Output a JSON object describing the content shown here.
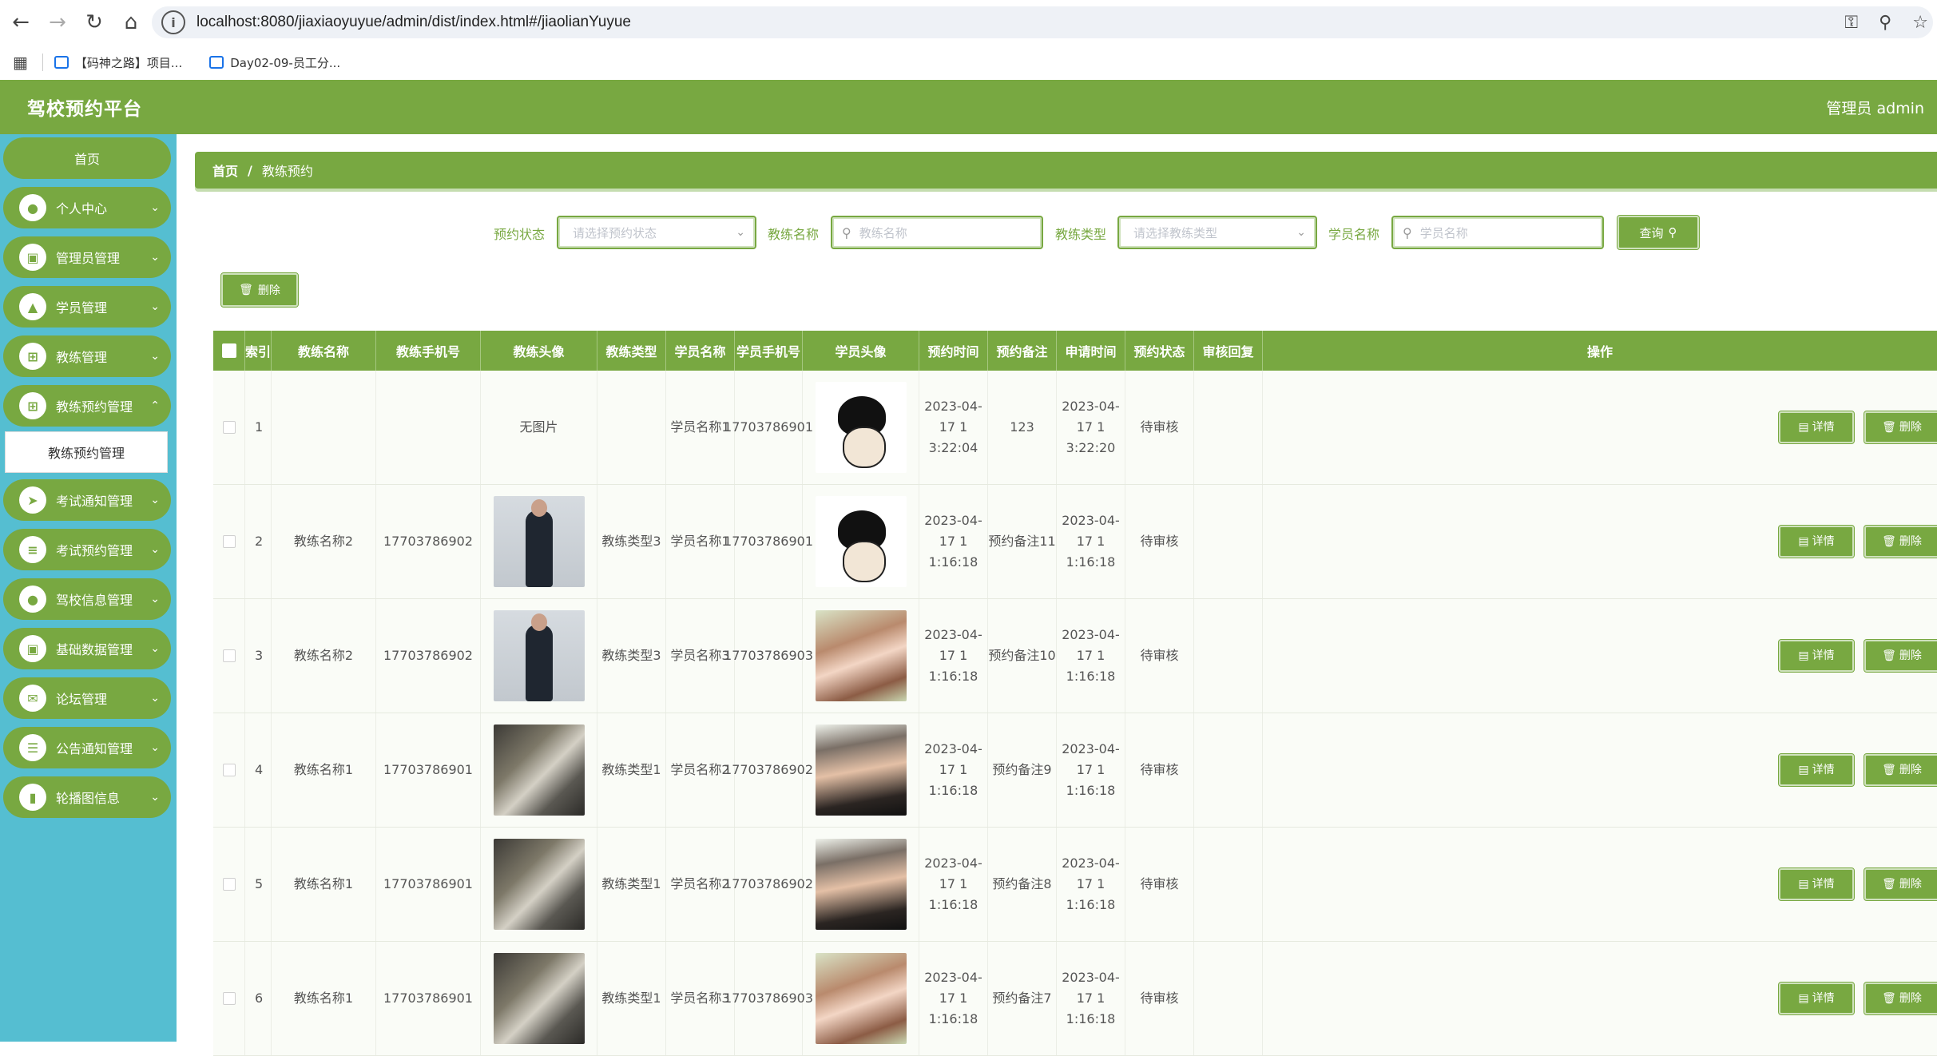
{
  "browser": {
    "url": "localhost:8080/jiaxiaoyuyue/admin/dist/index.html#/jiaolianYuyue",
    "bookmarks": [
      "【码神之路】项目...",
      "Day02-09-员工分..."
    ]
  },
  "header": {
    "title": "驾校预约平台",
    "user": "管理员 admin"
  },
  "sidebar": {
    "items": [
      {
        "label": "首页",
        "icon": "home-icon"
      },
      {
        "label": "个人中心",
        "icon": "user-icon"
      },
      {
        "label": "管理员管理",
        "icon": "briefcase-icon"
      },
      {
        "label": "学员管理",
        "icon": "chart-icon"
      },
      {
        "label": "教练管理",
        "icon": "grid-icon"
      },
      {
        "label": "教练预约管理",
        "icon": "grid-icon"
      },
      {
        "label": "考试通知管理",
        "icon": "send-icon"
      },
      {
        "label": "考试预约管理",
        "icon": "list-icon"
      },
      {
        "label": "驾校信息管理",
        "icon": "user-icon"
      },
      {
        "label": "基础数据管理",
        "icon": "briefcase-icon"
      },
      {
        "label": "论坛管理",
        "icon": "message-icon"
      },
      {
        "label": "公告通知管理",
        "icon": "sliders-icon"
      },
      {
        "label": "轮播图信息",
        "icon": "book-icon"
      }
    ],
    "submenu": {
      "label": "教练预约管理"
    }
  },
  "breadcrumb": {
    "home": "首页",
    "sep": "/",
    "current": "教练预约"
  },
  "search": {
    "status_label": "预约状态",
    "status_placeholder": "请选择预约状态",
    "coach_name_label": "教练名称",
    "coach_name_placeholder": "教练名称",
    "coach_type_label": "教练类型",
    "coach_type_placeholder": "请选择教练类型",
    "student_name_label": "学员名称",
    "student_name_placeholder": "学员名称",
    "query_label": "查询"
  },
  "toolbar": {
    "delete_label": "删除"
  },
  "table": {
    "columns": [
      "索引",
      "教练名称",
      "教练手机号",
      "教练头像",
      "教练类型",
      "学员名称",
      "学员手机号",
      "学员头像",
      "预约时间",
      "预约备注",
      "申请时间",
      "预约状态",
      "审核回复",
      "操作"
    ],
    "detail_label": "详情",
    "delete_label": "删除",
    "rows": [
      {
        "index": "1",
        "coach_name": "",
        "coach_phone": "",
        "coach_avatar": "none",
        "coach_avatar_text": "无图片",
        "coach_type": "",
        "student_name": "学员名称1",
        "student_phone": "17703786901",
        "student_avatar": "toon",
        "book_time_1": "2023-04-17 1",
        "book_time_2": "3:22:04",
        "note": "123",
        "apply_time_1": "2023-04-17 1",
        "apply_time_2": "3:22:20",
        "status": "待审核",
        "reply": ""
      },
      {
        "index": "2",
        "coach_name": "教练名称2",
        "coach_phone": "17703786902",
        "coach_avatar": "suit",
        "coach_avatar_text": "",
        "coach_type": "教练类型3",
        "student_name": "学员名称1",
        "student_phone": "17703786901",
        "student_avatar": "toon",
        "book_time_1": "2023-04-17 1",
        "book_time_2": "1:16:18",
        "note": "预约备注11",
        "apply_time_1": "2023-04-17 1",
        "apply_time_2": "1:16:18",
        "status": "待审核",
        "reply": ""
      },
      {
        "index": "3",
        "coach_name": "教练名称2",
        "coach_phone": "17703786902",
        "coach_avatar": "suit",
        "coach_avatar_text": "",
        "coach_type": "教练类型3",
        "student_name": "学员名称3",
        "student_phone": "17703786903",
        "student_avatar": "girl",
        "book_time_1": "2023-04-17 1",
        "book_time_2": "1:16:18",
        "note": "预约备注10",
        "apply_time_1": "2023-04-17 1",
        "apply_time_2": "1:16:18",
        "status": "待审核",
        "reply": ""
      },
      {
        "index": "4",
        "coach_name": "教练名称1",
        "coach_phone": "17703786901",
        "coach_avatar": "gym",
        "coach_avatar_text": "",
        "coach_type": "教练类型1",
        "student_name": "学员名称2",
        "student_phone": "17703786902",
        "student_avatar": "man",
        "book_time_1": "2023-04-17 1",
        "book_time_2": "1:16:18",
        "note": "预约备注9",
        "apply_time_1": "2023-04-17 1",
        "apply_time_2": "1:16:18",
        "status": "待审核",
        "reply": ""
      },
      {
        "index": "5",
        "coach_name": "教练名称1",
        "coach_phone": "17703786901",
        "coach_avatar": "gym",
        "coach_avatar_text": "",
        "coach_type": "教练类型1",
        "student_name": "学员名称2",
        "student_phone": "17703786902",
        "student_avatar": "man",
        "book_time_1": "2023-04-17 1",
        "book_time_2": "1:16:18",
        "note": "预约备注8",
        "apply_time_1": "2023-04-17 1",
        "apply_time_2": "1:16:18",
        "status": "待审核",
        "reply": ""
      },
      {
        "index": "6",
        "coach_name": "教练名称1",
        "coach_phone": "17703786901",
        "coach_avatar": "gym",
        "coach_avatar_text": "",
        "coach_type": "教练类型1",
        "student_name": "学员名称3",
        "student_phone": "17703786903",
        "student_avatar": "girl",
        "book_time_1": "2023-04-17 1",
        "book_time_2": "1:16:18",
        "note": "预约备注7",
        "apply_time_1": "2023-04-17 1",
        "apply_time_2": "1:16:18",
        "status": "待审核",
        "reply": ""
      }
    ]
  },
  "colors": {
    "accent": "#78a841",
    "sidebar": "#55bed1"
  }
}
